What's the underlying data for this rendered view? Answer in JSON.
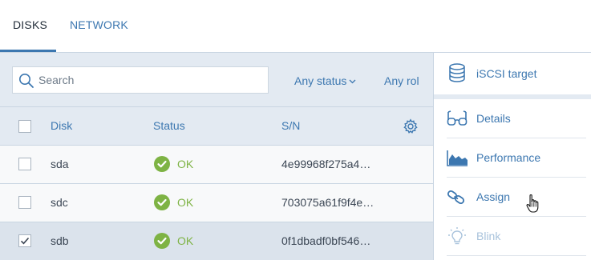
{
  "tabs": [
    {
      "label": "DISKS",
      "active": true
    },
    {
      "label": "NETWORK",
      "active": false
    }
  ],
  "search": {
    "placeholder": "Search",
    "value": ""
  },
  "filters": {
    "status": "Any status",
    "role": "Any rol"
  },
  "table": {
    "columns": [
      "Disk",
      "Status",
      "S/N"
    ],
    "rows": [
      {
        "disk": "sda",
        "status": "OK",
        "sn": "4e99968f275a4…",
        "checked": false
      },
      {
        "disk": "sdc",
        "status": "OK",
        "sn": "703075a61f9f4e…",
        "checked": false
      },
      {
        "disk": "sdb",
        "status": "OK",
        "sn": "0f1dbadf0bf546…",
        "checked": true
      }
    ]
  },
  "right_panel": {
    "iscsi_label": "iSCSI target",
    "actions": [
      {
        "label": "Details",
        "icon": "glasses-icon",
        "enabled": true
      },
      {
        "label": "Performance",
        "icon": "area-chart-icon",
        "enabled": true
      },
      {
        "label": "Assign",
        "icon": "link-icon",
        "enabled": true
      },
      {
        "label": "Blink",
        "icon": "lightbulb-icon",
        "enabled": false
      }
    ]
  },
  "colors": {
    "accent": "#3c77b0",
    "ok": "#7eb344",
    "selected_row": "#dbe3ec",
    "panel_bg": "#e3eaf2"
  }
}
